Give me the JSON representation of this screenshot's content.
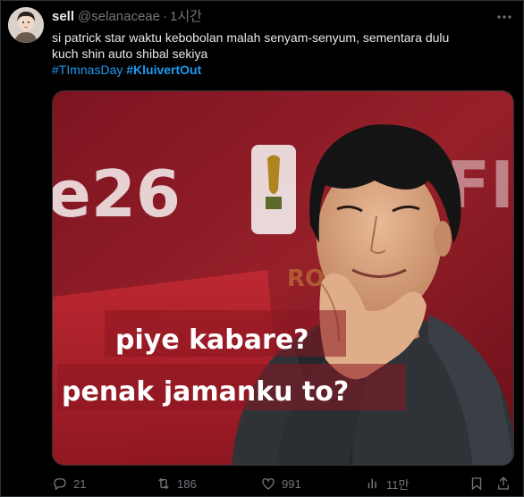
{
  "tweet": {
    "display_name": "sell",
    "handle": "@selanaceae",
    "separator": "·",
    "time": "1시간",
    "text_line1": "si patrick star waktu kebobolan malah senyam-senyum, sementara dulu",
    "text_line2": "kuch shin auto shibal sekiya",
    "hashtags": [
      "#TImnasDay",
      "#KluivertOut"
    ]
  },
  "media": {
    "background_text": "e26",
    "background_text_right": "FIE",
    "watermark": "RONALDO",
    "meme_line1": "piye kabare?",
    "meme_line2": "penak jamanku to?"
  },
  "actions": {
    "replies": "21",
    "reposts": "186",
    "likes": "991",
    "views": "11만"
  },
  "icons": {
    "more": "more-icon",
    "reply": "reply-icon",
    "repost": "repost-icon",
    "like": "like-icon",
    "views": "views-icon",
    "bookmark": "bookmark-icon",
    "share": "share-icon"
  },
  "colors": {
    "background": "#000000",
    "text": "#e7e9ea",
    "muted": "#71767b",
    "link": "#1d9bf0",
    "image_bg": "#8a1723"
  }
}
